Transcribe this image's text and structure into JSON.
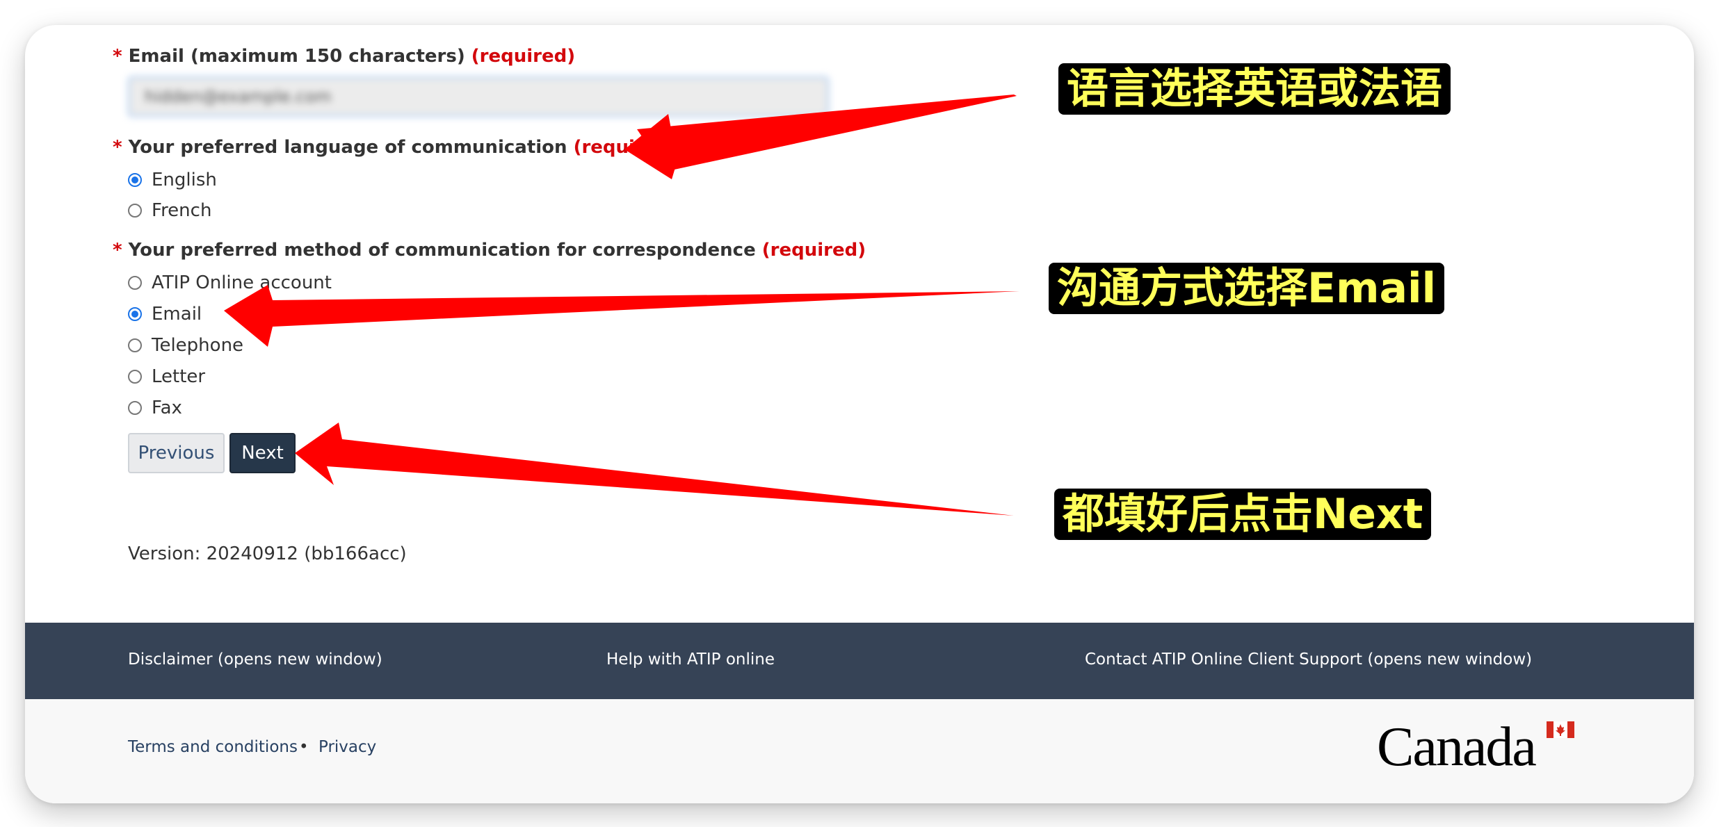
{
  "form": {
    "email": {
      "label": "Email (maximum 150 characters)",
      "required": "(required)",
      "value": "hidden@example.com"
    },
    "language": {
      "label": "Your preferred language of communication",
      "required": "(required)",
      "options": [
        {
          "label": "English",
          "checked": true
        },
        {
          "label": "French",
          "checked": false
        }
      ]
    },
    "method": {
      "label": "Your preferred method of communication for correspondence",
      "required": "(required)",
      "options": [
        {
          "label": "ATIP Online account",
          "checked": false
        },
        {
          "label": "Email",
          "checked": true
        },
        {
          "label": "Telephone",
          "checked": false
        },
        {
          "label": "Letter",
          "checked": false
        },
        {
          "label": "Fax",
          "checked": false
        }
      ]
    },
    "star": "*",
    "previous_label": "Previous",
    "next_label": "Next",
    "version": "Version: 20240912 (bb166acc)"
  },
  "footer": {
    "links": [
      "Disclaimer (opens new window)",
      "Help with ATIP online",
      "Contact ATIP Online Client Support (opens new window)"
    ],
    "sub_links": [
      "Terms and conditions",
      "Privacy"
    ],
    "bullet": "•",
    "wordmark": "Canada"
  },
  "annotations": {
    "language": "语言选择英语或法语",
    "method": "沟通方式选择Email",
    "next": "都填好后点击Next"
  },
  "colors": {
    "required_red": "#d3080c",
    "footer_dark": "#364356",
    "next_button": "#26374a",
    "callout_text": "#ffff5a",
    "arrow_red": "#ff0000"
  }
}
